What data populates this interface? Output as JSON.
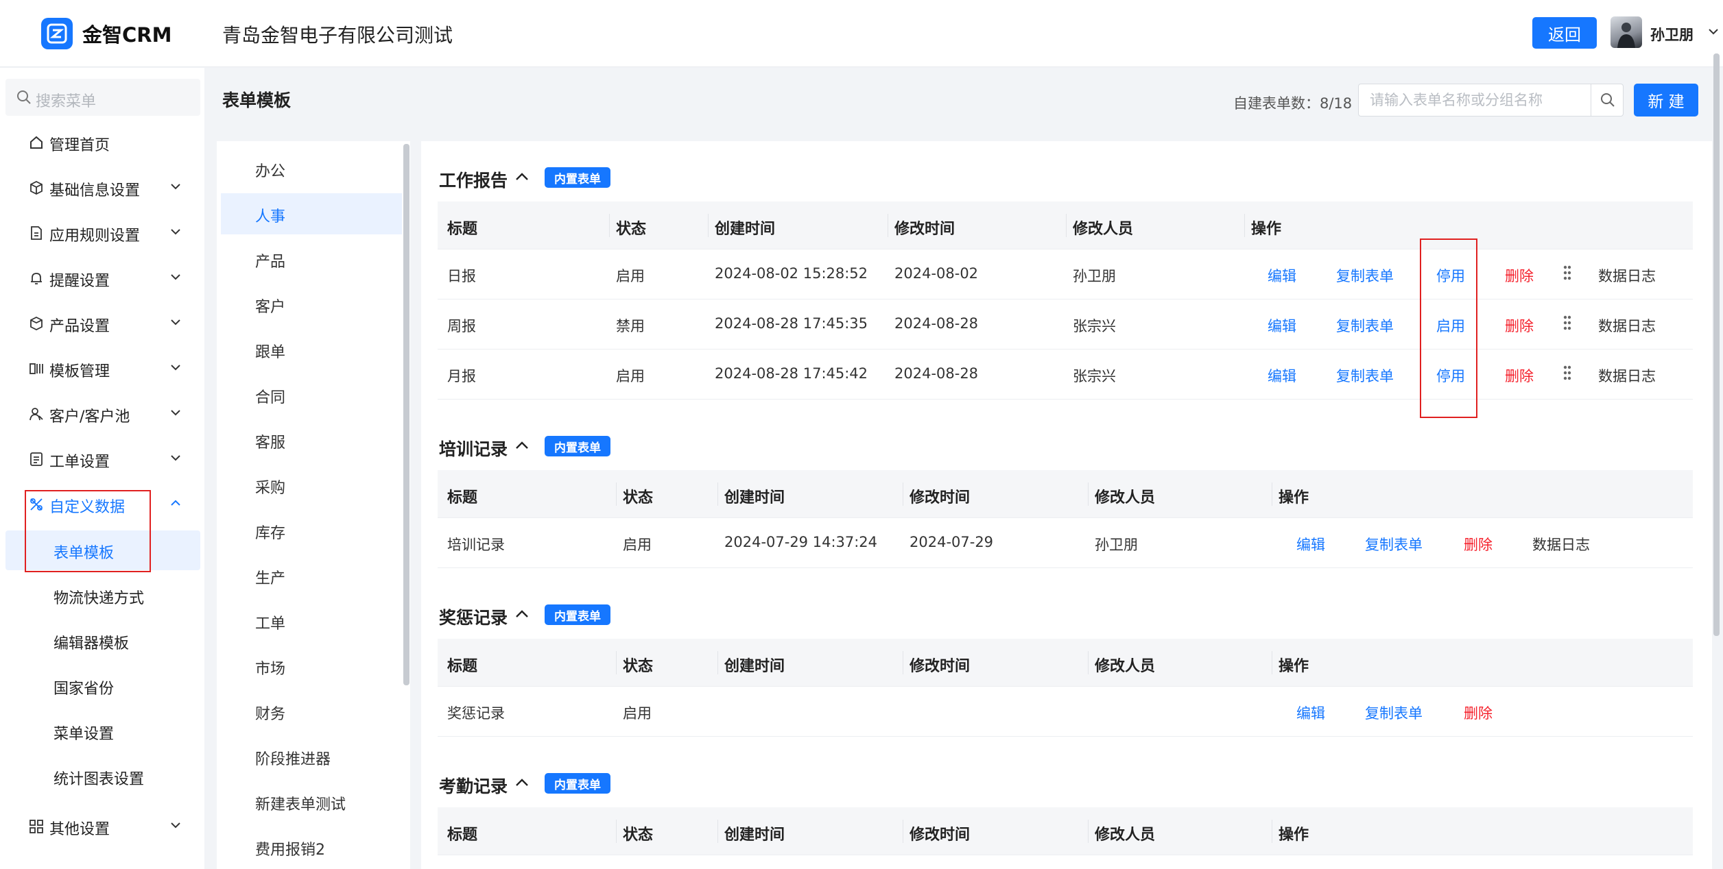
{
  "app": {
    "logo_text": "金智CRM",
    "company": "青岛金智电子有限公司测试",
    "back_label": "返回",
    "username": "孙卫朋"
  },
  "sidebar": {
    "search_placeholder": "搜索菜单",
    "items": [
      {
        "label": "管理首页",
        "icon": "home-icon"
      },
      {
        "label": "基础信息设置",
        "icon": "box-icon"
      },
      {
        "label": "应用规则设置",
        "icon": "document-icon"
      },
      {
        "label": "提醒设置",
        "icon": "bell-icon"
      },
      {
        "label": "产品设置",
        "icon": "cube-icon"
      },
      {
        "label": "模板管理",
        "icon": "template-icon"
      },
      {
        "label": "客户/客户池",
        "icon": "user-icon"
      },
      {
        "label": "工单设置",
        "icon": "ticket-icon"
      },
      {
        "label": "自定义数据",
        "icon": "custom-icon"
      }
    ],
    "sub_items": [
      "表单模板",
      "物流快递方式",
      "编辑器模板",
      "国家省份",
      "菜单设置",
      "统计图表设置"
    ],
    "bottom_item": {
      "label": "其他设置",
      "icon": "grid-icon"
    }
  },
  "header": {
    "title": "表单模板",
    "count_label": "自建表单数：8/18",
    "search_placeholder": "请输入表单名称或分组名称",
    "new_label": "新 建"
  },
  "categories": [
    "办公",
    "人事",
    "产品",
    "客户",
    "跟单",
    "合同",
    "客服",
    "采购",
    "库存",
    "生产",
    "工单",
    "市场",
    "财务",
    "阶段推进器",
    "新建表单测试",
    "费用报销2"
  ],
  "selected_category": "人事",
  "table_headers": {
    "title": "标题",
    "status": "状态",
    "created": "创建时间",
    "modified": "修改时间",
    "modifier": "修改人员",
    "ops": "操作"
  },
  "actions": {
    "edit": "编辑",
    "copy": "复制表单",
    "disable": "停用",
    "enable": "启用",
    "delete": "删除",
    "log": "数据日志"
  },
  "groups": [
    {
      "name": "工作报告",
      "tag": "内置表单",
      "rows": [
        {
          "title": "日报",
          "status": "启用",
          "created": "2024-08-02 15:28:52",
          "modified": "2024-08-02",
          "modifier": "孙卫朋",
          "toggle": "停用"
        },
        {
          "title": "周报",
          "status": "禁用",
          "created": "2024-08-28 17:45:35",
          "modified": "2024-08-28",
          "modifier": "张宗兴",
          "toggle": "启用"
        },
        {
          "title": "月报",
          "status": "启用",
          "created": "2024-08-28 17:45:42",
          "modified": "2024-08-28",
          "modifier": "张宗兴",
          "toggle": "停用"
        }
      ]
    },
    {
      "name": "培训记录",
      "tag": "内置表单",
      "rows": [
        {
          "title": "培训记录",
          "status": "启用",
          "created": "2024-07-29 14:37:24",
          "modified": "2024-07-29",
          "modifier": "孙卫朋"
        }
      ]
    },
    {
      "name": "奖惩记录",
      "tag": "内置表单",
      "rows": [
        {
          "title": "奖惩记录",
          "status": "启用",
          "created": "",
          "modified": "",
          "modifier": ""
        }
      ]
    },
    {
      "name": "考勤记录",
      "tag": "内置表单",
      "rows": []
    }
  ],
  "colors": {
    "primary": "#1677ff",
    "danger": "#f5222d",
    "highlight_box": "#e02020"
  }
}
